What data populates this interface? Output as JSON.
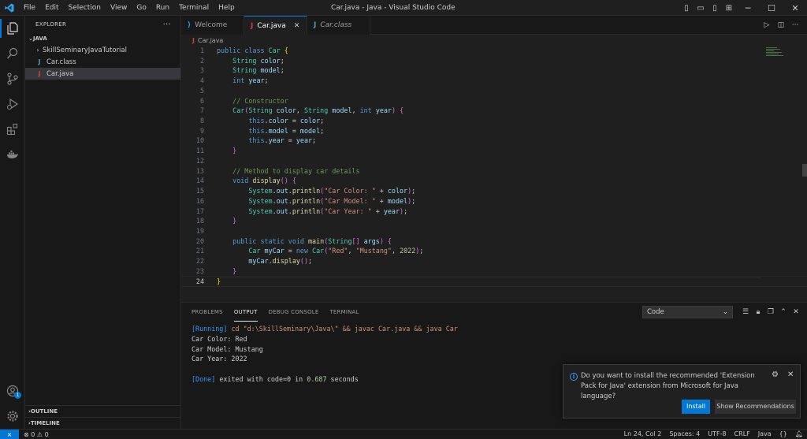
{
  "window": {
    "title": "Car.java - Java - Visual Studio Code",
    "menu": [
      "File",
      "Edit",
      "Selection",
      "View",
      "Go",
      "Run",
      "Terminal",
      "Help"
    ]
  },
  "sidebar": {
    "header": "EXPLORER",
    "section": "JAVA",
    "items": [
      {
        "label": "SkillSeminaryJavaTutorial",
        "type": "folder"
      },
      {
        "label": "Car.class",
        "type": "class"
      },
      {
        "label": "Car.java",
        "type": "java"
      }
    ],
    "outline": "OUTLINE",
    "timeline": "TIMELINE"
  },
  "tabs": [
    {
      "label": "Welcome"
    },
    {
      "label": "Car.java"
    },
    {
      "label": "Car.class"
    }
  ],
  "breadcrumb": "Car.java",
  "code_lines": [
    "public class Car {",
    "    String color;",
    "    String model;",
    "    int year;",
    "",
    "    // Constructor",
    "    Car(String color, String model, int year) {",
    "        this.color = color;",
    "        this.model = model;",
    "        this.year = year;",
    "    }",
    "",
    "    // Method to display car details",
    "    void display() {",
    "        System.out.println(\"Car Color: \" + color);",
    "        System.out.println(\"Car Model: \" + model);",
    "        System.out.println(\"Car Year: \" + year);",
    "    }",
    "",
    "    public static void main(String[] args) {",
    "        Car myCar = new Car(\"Red\", \"Mustang\", 2022);",
    "        myCar.display();",
    "    }",
    "}"
  ],
  "panel": {
    "tabs": [
      "PROBLEMS",
      "OUTPUT",
      "DEBUG CONSOLE",
      "TERMINAL"
    ],
    "active_tab": "OUTPUT",
    "channel": "Code",
    "output": {
      "running_tag": "[Running]",
      "command": "cd \"d:\\SkillSeminary\\Java\\\" && javac Car.java && java Car",
      "lines": [
        "Car Color: Red",
        "Car Model: Mustang",
        "Car Year: 2022"
      ],
      "done_tag": "[Done]",
      "done_prefix": "exited with",
      "done_code": "code=0",
      "done_in": "in",
      "done_time": "0.687",
      "done_unit": "seconds"
    }
  },
  "notification": {
    "message": "Do you want to install the recommended 'Extension Pack for Java' extension from Microsoft for Java language?",
    "install_label": "Install",
    "show_label": "Show Recommendations"
  },
  "statusbar": {
    "errors": "0",
    "warnings": "0",
    "position": "Ln 24, Col 2",
    "spaces": "Spaces: 4",
    "encoding": "UTF-8",
    "eol": "CRLF",
    "language": "Java"
  },
  "colors": {
    "accent": "#0078d4",
    "java_icon": "#cc3e44",
    "class_icon": "#519aba"
  }
}
